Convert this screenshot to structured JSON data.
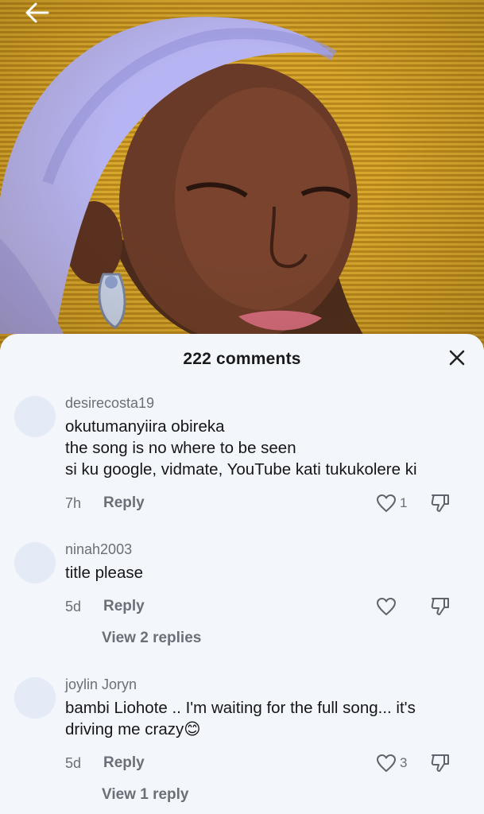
{
  "header": {
    "title": "222 comments"
  },
  "icons": {
    "back": "arrow-left-icon",
    "close": "close-icon",
    "like": "heart-icon",
    "dislike": "thumbs-down-icon"
  },
  "colors": {
    "sheet_background": "#f3f6fb",
    "text_primary": "#161616",
    "text_secondary": "#6b6f78",
    "avatar_placeholder": "#e4ebf7",
    "video_background": "#d8a82e"
  },
  "comments": [
    {
      "username": "desirecosta19",
      "lines": [
        "okutumanyiira obireka",
        "the song is no where to be seen",
        "si ku google, vidmate, YouTube kati tukukolere ki"
      ],
      "time": "7h",
      "reply_label": "Reply",
      "likes": "1",
      "view_replies": ""
    },
    {
      "username": "ninah2003",
      "lines": [
        "title please"
      ],
      "time": "5d",
      "reply_label": "Reply",
      "likes": "",
      "view_replies": "View 2 replies"
    },
    {
      "username": "joylin Joryn",
      "lines": [
        "bambi Liohote .. I'm waiting for the full song... it's",
        "driving me crazy😊"
      ],
      "time": "5d",
      "reply_label": "Reply",
      "likes": "3",
      "view_replies": "View 1 reply"
    }
  ]
}
